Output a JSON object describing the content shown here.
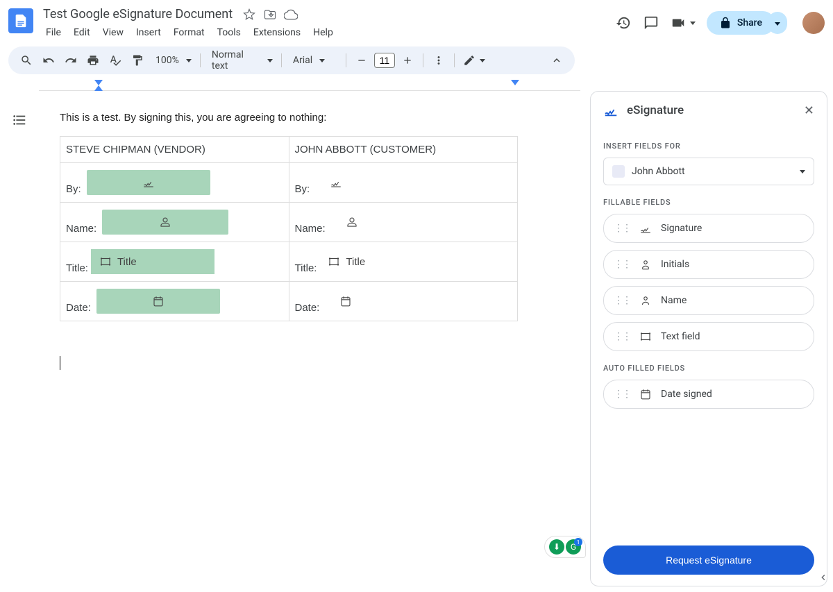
{
  "doc": {
    "title": "Test Google eSignature Document"
  },
  "menus": {
    "file": "File",
    "edit": "Edit",
    "view": "View",
    "insert": "Insert",
    "format": "Format",
    "tools": "Tools",
    "extensions": "Extensions",
    "help": "Help"
  },
  "toolbar": {
    "zoom": "100%",
    "style": "Normal text",
    "font": "Arial",
    "font_size": "11"
  },
  "share": {
    "label": "Share"
  },
  "document": {
    "intro": "This is a test. By signing this, you are agreeing to nothing:",
    "col1_header": "STEVE CHIPMAN (VENDOR)",
    "col2_header": "JOHN ABBOTT (CUSTOMER)",
    "labels": {
      "by": "By:",
      "name": "Name:",
      "title": "Title:",
      "date": "Date:"
    },
    "title_placeholder": "Title"
  },
  "sidebar": {
    "title": "eSignature",
    "insert_for_label": "INSERT FIELDS FOR",
    "signer": "John Abbott",
    "fillable_label": "FILLABLE FIELDS",
    "fields": {
      "signature": "Signature",
      "initials": "Initials",
      "name": "Name",
      "text": "Text field"
    },
    "auto_label": "AUTO FILLED FIELDS",
    "date_signed": "Date signed",
    "request_btn": "Request eSignature"
  },
  "badge_count": "1"
}
